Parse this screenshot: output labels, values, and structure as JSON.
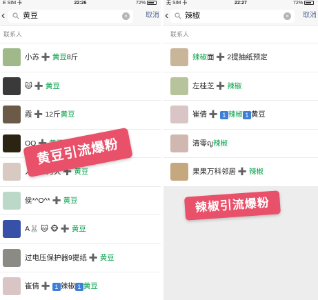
{
  "left": {
    "status": {
      "carrier": "E SIM 卡",
      "time": "22:26",
      "battery": "72%"
    },
    "search": {
      "back": "‹",
      "query": "黄豆",
      "cancel": "取消"
    },
    "section_title": "联系人",
    "plus": "➕",
    "rows": [
      {
        "pre": "小苏 ",
        "hl": "黄豆",
        "post": "8斤",
        "avatar": "#9fb98a"
      },
      {
        "pre": "🐱 ",
        "hl": "黄豆",
        "post": "",
        "avatar": "#3a3a3a"
      },
      {
        "pre": "霞 ",
        "mid": "12斤",
        "hl": "黄豆",
        "post": "",
        "avatar": "#6b5a48"
      },
      {
        "pre": "OO ",
        "hl": "黄豆",
        "post": "",
        "avatar": "#2b2412"
      },
      {
        "pre": "人间四月天 ",
        "hl": "黄豆",
        "post": "",
        "avatar": "#d8c9c2"
      },
      {
        "pre": "侯*^O^* ",
        "hl": "黄豆",
        "post": "",
        "avatar": "#bcd8c9"
      },
      {
        "pre": "A🐰 🐱 🐵 ",
        "hl": "黄豆",
        "post": "",
        "avatar": "#3750a8"
      },
      {
        "pre": "过电压保护器9提纸 ",
        "hl": "黄豆",
        "post": "",
        "avatar": "#8c8a85"
      },
      {
        "pre": "崔倩 ",
        "num1": "1",
        "mid_text": "辣椒",
        "num2": "1",
        "hl": "黄豆",
        "post": "",
        "avatar": "#d9c4c6"
      }
    ],
    "badge": "黄豆引流爆粉"
  },
  "right": {
    "status": {
      "carrier": "无 SIM 卡",
      "time": "22:27",
      "battery": "72%"
    },
    "search": {
      "back": "‹",
      "query": "辣椒",
      "cancel": "取消"
    },
    "section_title": "联系人",
    "plus": "➕",
    "rows": [
      {
        "hl": "辣椒",
        "post": "面 ➕ 2提抽纸预定",
        "avatar": "#c9b59a"
      },
      {
        "pre": "左桂芝 ",
        "hl": "辣椒",
        "post": "",
        "avatar": "#b7c39a"
      },
      {
        "pre": "崔倩 ",
        "num1": "1",
        "hl": "辣椒",
        "num2": "1",
        "post": "黄豆",
        "avatar": "#d9c4c6"
      },
      {
        "pre": "清零ญ",
        "hl": "辣椒",
        "post": "",
        "avatar": "#d0b8b0"
      },
      {
        "pre": "果果万科邻居 ",
        "hl": "辣椒",
        "post": "",
        "avatar": "#c5a87e"
      }
    ],
    "badge": "辣椒引流爆粉"
  },
  "colors": {
    "highlight": "#07a34a",
    "cancel": "#576b95",
    "badge": "#e9506a",
    "number_tag": "#3d7fd6"
  },
  "icons": {
    "search": "search-icon",
    "clear": "clear-icon",
    "back": "back-icon",
    "battery": "battery-icon"
  }
}
